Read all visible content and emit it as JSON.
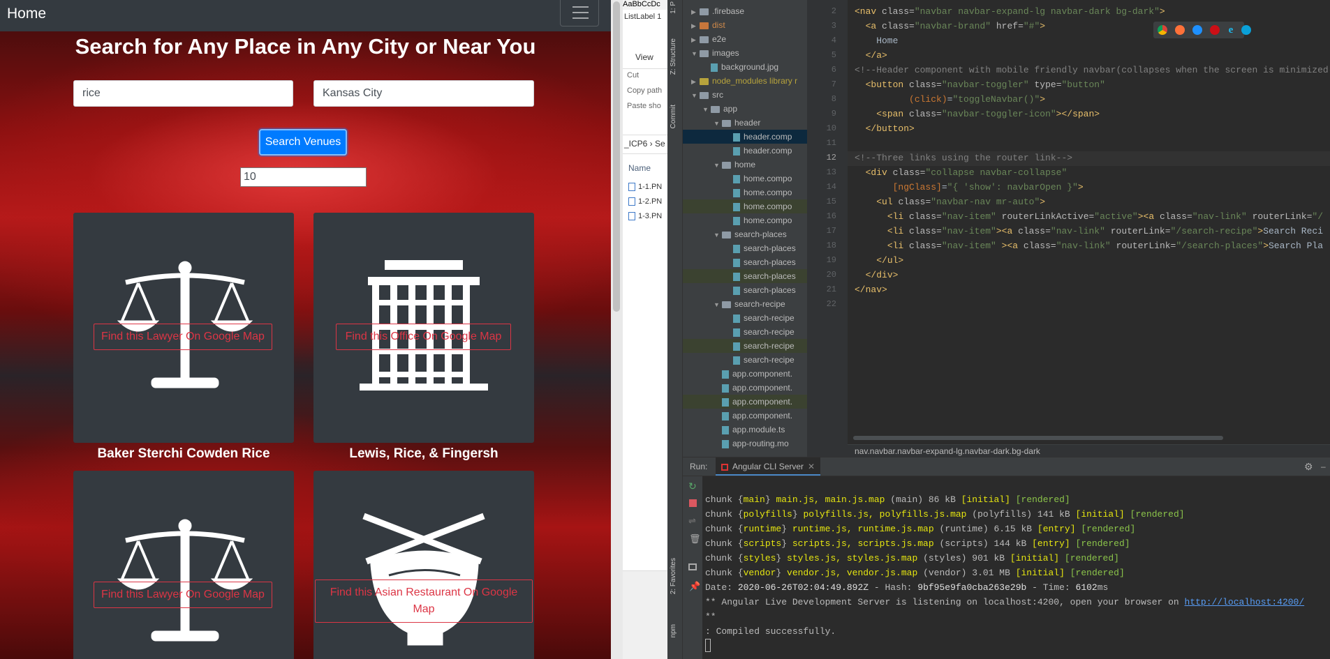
{
  "app": {
    "brand": "Home",
    "heading": "Search for Any Place in Any City or Near You",
    "search": {
      "query": "rice",
      "city": "Kansas City",
      "button": "Search Venues",
      "limit": "10"
    },
    "cards": [
      {
        "icon": "scales-icon",
        "button": "Find this Lawyer On Google Map",
        "name": "Baker Sterchi Cowden Rice"
      },
      {
        "icon": "office-building-icon",
        "button": "Find this Office On Google Map",
        "name": "Lewis, Rice, & Fingersh"
      },
      {
        "icon": "scales-icon",
        "button": "Find this Lawyer On Google Map",
        "name": ""
      },
      {
        "icon": "rice-bowl-chopsticks-icon",
        "button": "Find this Asian Restaurant On Google Map",
        "name": ""
      }
    ]
  },
  "explorer": {
    "top": "AaBbCcDc",
    "listlabel": "ListLabel 1",
    "view": "View",
    "cut": "Cut",
    "copypath": "Copy path",
    "paste": "Paste sho",
    "crumb": "_ICP6  ›  Se",
    "col": "Name",
    "files": [
      "1-1.PN",
      "1-2.PN",
      "1-3.PN"
    ]
  },
  "ide": {
    "side_labels": [
      "1: P",
      "Z: Structure",
      "Commit",
      "2: Favorites",
      "npm"
    ],
    "tree": [
      {
        "name": ".firebase",
        "indent": 1,
        "type": "folder",
        "arrow": "right"
      },
      {
        "name": "dist",
        "indent": 1,
        "type": "folder-excluded",
        "arrow": "right"
      },
      {
        "name": "e2e",
        "indent": 1,
        "type": "folder",
        "arrow": "right"
      },
      {
        "name": "images",
        "indent": 1,
        "type": "folder",
        "arrow": "down"
      },
      {
        "name": "background.jpg",
        "indent": 2,
        "type": "file"
      },
      {
        "name": "node_modules  library r",
        "indent": 1,
        "type": "folder-lib",
        "arrow": "right"
      },
      {
        "name": "src",
        "indent": 1,
        "type": "folder",
        "arrow": "down"
      },
      {
        "name": "app",
        "indent": 2,
        "type": "folder",
        "arrow": "down"
      },
      {
        "name": "header",
        "indent": 3,
        "type": "folder",
        "arrow": "down"
      },
      {
        "name": "header.comp",
        "indent": 4,
        "type": "file",
        "selected": true
      },
      {
        "name": "header.comp",
        "indent": 4,
        "type": "file"
      },
      {
        "name": "home",
        "indent": 3,
        "type": "folder",
        "arrow": "down"
      },
      {
        "name": "home.compo",
        "indent": 4,
        "type": "file"
      },
      {
        "name": "home.compo",
        "indent": 4,
        "type": "file"
      },
      {
        "name": "home.compo",
        "indent": 4,
        "type": "file",
        "modified": true
      },
      {
        "name": "home.compo",
        "indent": 4,
        "type": "file"
      },
      {
        "name": "search-places",
        "indent": 3,
        "type": "folder",
        "arrow": "down"
      },
      {
        "name": "search-places",
        "indent": 4,
        "type": "file"
      },
      {
        "name": "search-places",
        "indent": 4,
        "type": "file"
      },
      {
        "name": "search-places",
        "indent": 4,
        "type": "file",
        "modified": true
      },
      {
        "name": "search-places",
        "indent": 4,
        "type": "file"
      },
      {
        "name": "search-recipe",
        "indent": 3,
        "type": "folder",
        "arrow": "down"
      },
      {
        "name": "search-recipe",
        "indent": 4,
        "type": "file"
      },
      {
        "name": "search-recipe",
        "indent": 4,
        "type": "file"
      },
      {
        "name": "search-recipe",
        "indent": 4,
        "type": "file",
        "modified": true
      },
      {
        "name": "search-recipe",
        "indent": 4,
        "type": "file"
      },
      {
        "name": "app.component.",
        "indent": 3,
        "type": "file"
      },
      {
        "name": "app.component.",
        "indent": 3,
        "type": "file"
      },
      {
        "name": "app.component.",
        "indent": 3,
        "type": "file",
        "modified": true
      },
      {
        "name": "app.component.",
        "indent": 3,
        "type": "file"
      },
      {
        "name": "app.module.ts",
        "indent": 3,
        "type": "file"
      },
      {
        "name": "app-routing.mo",
        "indent": 3,
        "type": "file"
      }
    ],
    "line_numbers": [
      "2",
      "3",
      "4",
      "5",
      "6",
      "7",
      "8",
      "9",
      "10",
      "11",
      "12",
      "13",
      "14",
      "15",
      "16",
      "17",
      "18",
      "19",
      "20",
      "21",
      "22"
    ],
    "code": [
      "<span class='t'>&lt;nav </span><span class='a'>class=</span><span class='v'>\"navbar navbar-expand-lg navbar-dark bg-dark\"</span><span class='t'>&gt;</span>",
      "  <span class='t'>&lt;a </span><span class='a'>class=</span><span class='v'>\"navbar-brand\"</span> <span class='a'>href=</span><span class='v'>\"#\"</span><span class='t'>&gt;</span>",
      "    Home",
      "  <span class='t'>&lt;/a&gt;</span>",
      "<span class='c'>&lt;!--Header component with mobile friendly navbar(collapses when the screen is minimized--&gt;</span>",
      "  <span class='t'>&lt;button </span><span class='a'>class=</span><span class='v'>\"navbar-toggler\"</span> <span class='a'>type=</span><span class='v'>\"button\"</span>",
      "          <span class='e'>(click)</span>=<span class='v'>\"toggleNavbar()\"</span><span class='t'>&gt;</span>",
      "    <span class='t'>&lt;span </span><span class='a'>class=</span><span class='v'>\"navbar-toggler-icon\"</span><span class='t'>&gt;&lt;/span&gt;</span>",
      "  <span class='t'>&lt;/button&gt;</span>",
      "",
      "<span class='c'>&lt;!--Three links using the router link--&gt;</span>",
      "  <span class='t'>&lt;div </span><span class='a'>class=</span><span class='v'>\"collapse navbar-collapse\"</span>",
      "       <span class='e'>[ngClass]</span>=<span class='v'>\"{ 'show': navbarOpen }\"</span><span class='t'>&gt;</span>",
      "    <span class='t'>&lt;ul </span><span class='a'>class=</span><span class='v'>\"navbar-nav mr-auto\"</span><span class='t'>&gt;</span>",
      "      <span class='t'>&lt;li </span><span class='a'>class=</span><span class='v'>\"nav-item\"</span> <span class='a'>routerLinkActive=</span><span class='v'>\"active\"</span><span class='t'>&gt;&lt;a </span><span class='a'>class=</span><span class='v'>\"nav-link\"</span> <span class='a'>routerLink=</span><span class='v'>\"/</span>",
      "      <span class='t'>&lt;li </span><span class='a'>class=</span><span class='v'>\"nav-item\"</span><span class='t'>&gt;&lt;a </span><span class='a'>class=</span><span class='v'>\"nav-link\"</span> <span class='a'>routerLink=</span><span class='v'>\"/search-recipe\"</span><span class='t'>&gt;</span>Search Reci",
      "      <span class='t'>&lt;li </span><span class='a'>class=</span><span class='v'>\"nav-item\"</span> <span class='t'>&gt;&lt;a </span><span class='a'>class=</span><span class='v'>\"nav-link\"</span> <span class='a'>routerLink=</span><span class='v'>\"/search-places\"</span><span class='t'>&gt;</span>Search Pla",
      "    <span class='t'>&lt;/ul&gt;</span>",
      "  <span class='t'>&lt;/div&gt;</span>",
      "<span class='t'>&lt;/nav&gt;</span>",
      ""
    ],
    "breadcrumb": "nav.navbar.navbar-expand-lg.navbar-dark.bg-dark",
    "run_label": "Run:",
    "run_tab": "Angular CLI Server",
    "output": [
      "chunk {<span class='y'>main</span>} <span class='y'>main.js, main.js.map</span> (main) 86 kB <span class='y'>[initial]</span> <span class='g'>[rendered]</span>",
      "chunk {<span class='y'>polyfills</span>} <span class='y'>polyfills.js, polyfills.js.map</span> (polyfills) 141 kB <span class='y'>[initial]</span> <span class='g'>[rendered]</span>",
      "chunk {<span class='y'>runtime</span>} <span class='y'>runtime.js, runtime.js.map</span> (runtime) 6.15 kB <span class='y'>[entry]</span> <span class='g'>[rendered]</span>",
      "chunk {<span class='y'>scripts</span>} <span class='y'>scripts.js, scripts.js.map</span> (scripts) 144 kB <span class='y'>[entry]</span> <span class='g'>[rendered]</span>",
      "chunk {<span class='y'>styles</span>} <span class='y'>styles.js, styles.js.map</span> (styles) 901 kB <span class='y'>[initial]</span> <span class='g'>[rendered]</span>",
      "chunk {<span class='y'>vendor</span>} <span class='y'>vendor.js, vendor.js.map</span> (vendor) 3.01 MB <span class='y'>[initial]</span> <span class='g'>[rendered]</span>",
      "Date: <span class='w'>2020-06-26T02:04:49.892Z</span> - Hash: <span class='w'>9bf95e9fa0cba263e29b</span> - Time: <span class='w'>6102</span>ms",
      "** Angular Live Development Server is listening on localhost:4200, open your browser on <span class='lnk'>http://localhost:4200/</span>",
      "**",
      ": Compiled successfully."
    ]
  }
}
